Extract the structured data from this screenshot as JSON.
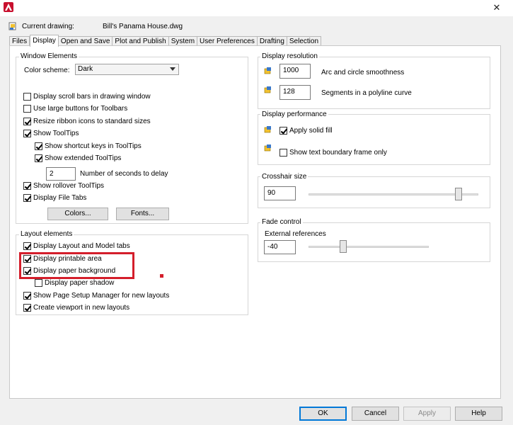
{
  "window": {
    "close_glyph": "✕",
    "app_icon": "autocad-logo-icon"
  },
  "header": {
    "current_label": "Current drawing:",
    "file_name": "Bill's Panama House.dwg"
  },
  "tabs": [
    {
      "label": "Files",
      "active": false
    },
    {
      "label": "Display",
      "active": true
    },
    {
      "label": "Open and Save",
      "active": false
    },
    {
      "label": "Plot and Publish",
      "active": false
    },
    {
      "label": "System",
      "active": false
    },
    {
      "label": "User Preferences",
      "active": false
    },
    {
      "label": "Drafting",
      "active": false
    },
    {
      "label": "Selection",
      "active": false
    }
  ],
  "window_elements": {
    "title": "Window Elements",
    "color_scheme_label": "Color scheme:",
    "color_scheme_value": "Dark",
    "options": [
      {
        "label": "Display scroll bars in drawing window",
        "checked": false
      },
      {
        "label": "Use large buttons for Toolbars",
        "checked": false
      },
      {
        "label": "Resize ribbon icons to standard sizes",
        "checked": true
      },
      {
        "label": "Show ToolTips",
        "checked": true
      },
      {
        "label": "Show shortcut keys in ToolTips",
        "checked": true
      },
      {
        "label": "Show extended ToolTips",
        "checked": true
      },
      {
        "label": "Show rollover ToolTips",
        "checked": true
      },
      {
        "label": "Display File Tabs",
        "checked": true
      }
    ],
    "delay_value": "2",
    "delay_label": "Number of seconds to delay",
    "colors_button": "Colors...",
    "fonts_button": "Fonts..."
  },
  "layout_elements": {
    "title": "Layout elements",
    "options": [
      {
        "label": "Display Layout and Model tabs",
        "checked": true
      },
      {
        "label": "Display printable area",
        "checked": true
      },
      {
        "label": "Display paper background",
        "checked": true
      },
      {
        "label": "Display paper shadow",
        "checked": false
      },
      {
        "label": "Show Page Setup Manager for new layouts",
        "checked": true
      },
      {
        "label": "Create viewport in new layouts",
        "checked": true
      }
    ]
  },
  "display_resolution": {
    "title": "Display resolution",
    "arc_value": "1000",
    "arc_label": "Arc and circle smoothness",
    "polyline_value": "128",
    "polyline_label": "Segments in a polyline curve"
  },
  "display_performance": {
    "title": "Display performance",
    "options": [
      {
        "label": "Apply solid fill",
        "checked": true
      },
      {
        "label": "Show text boundary frame only",
        "checked": false
      }
    ]
  },
  "crosshair": {
    "title": "Crosshair size",
    "value": "90",
    "slider_level": 90
  },
  "fade": {
    "title": "Fade control",
    "external_label": "External references",
    "value": "-40",
    "slider_level": 40
  },
  "footer": {
    "ok": "OK",
    "cancel": "Cancel",
    "apply": "Apply",
    "help": "Help"
  },
  "colors": {
    "highlight": "#d41e2b",
    "autocad_red": "#c8102e"
  }
}
